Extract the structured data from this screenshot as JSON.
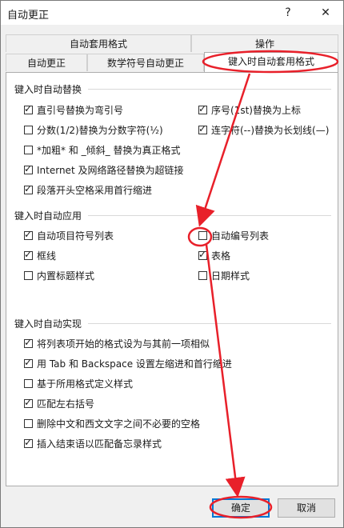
{
  "window": {
    "title": "自动更正",
    "help_glyph": "?",
    "close_glyph": "✕"
  },
  "tabs_row1": [
    {
      "label": "自动套用格式"
    },
    {
      "label": "操作"
    }
  ],
  "tabs_row2": [
    {
      "label": "自动更正"
    },
    {
      "label": "数学符号自动更正"
    },
    {
      "label": "键入时自动套用格式",
      "active": true
    }
  ],
  "sections": {
    "replace": "键入时自动替换",
    "apply": "键入时自动应用",
    "realize": "键入时自动实现"
  },
  "replace_items": [
    {
      "label": "直引号替换为弯引号",
      "checked": true
    },
    {
      "label": "序号(1st)替换为上标",
      "checked": true
    },
    {
      "label": "分数(1/2)替换为分数字符(½)",
      "checked": false
    },
    {
      "label": "连字符(--)替换为长划线(—)",
      "checked": true
    },
    {
      "label": "*加粗* 和 _倾斜_ 替换为真正格式",
      "checked": false
    },
    {
      "label": "Internet 及网络路径替换为超链接",
      "checked": true
    },
    {
      "label": "段落开头空格采用首行缩进",
      "checked": true
    }
  ],
  "apply_items": [
    {
      "label": "自动项目符号列表",
      "checked": true
    },
    {
      "label": "自动编号列表",
      "checked": false
    },
    {
      "label": "框线",
      "checked": true
    },
    {
      "label": "表格",
      "checked": true
    },
    {
      "label": "内置标题样式",
      "checked": false
    },
    {
      "label": "日期样式",
      "checked": false
    }
  ],
  "realize_items": [
    {
      "label": "将列表项开始的格式设为与其前一项相似",
      "checked": true
    },
    {
      "label": "用 Tab 和 Backspace 设置左缩进和首行缩进",
      "checked": true
    },
    {
      "label": "基于所用格式定义样式",
      "checked": false
    },
    {
      "label": "匹配左右括号",
      "checked": true
    },
    {
      "label": "删除中文和西文文字之间不必要的空格",
      "checked": false
    },
    {
      "label": "插入结束语以匹配备忘录样式",
      "checked": true
    }
  ],
  "buttons": {
    "ok": "确定",
    "cancel": "取消"
  },
  "annotation_color": "#e8202a",
  "check_glyph": "✓"
}
